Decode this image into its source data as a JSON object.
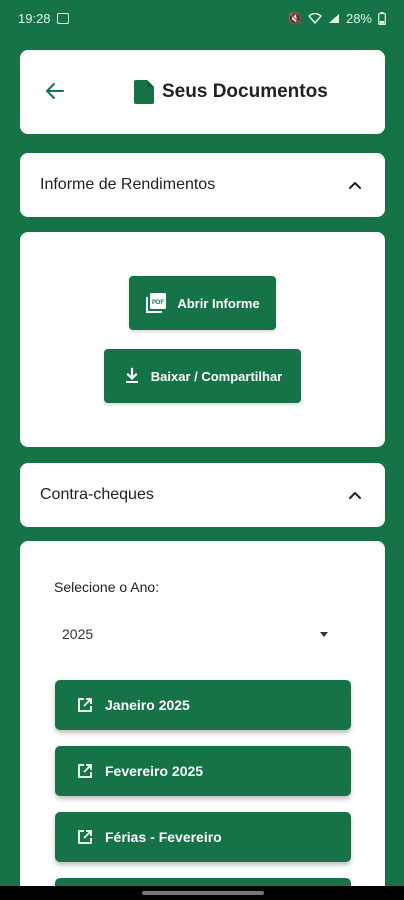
{
  "status_bar": {
    "time": "19:28",
    "battery": "28%"
  },
  "header": {
    "title": "Seus Documentos"
  },
  "informe": {
    "section_title": "Informe de Rendimentos",
    "open_label": "Abrir Informe",
    "download_label": "Baixar / Compartilhar",
    "pdf_icon_text": "PDF"
  },
  "contra": {
    "section_title": "Contra-cheques",
    "select_label": "Selecione o Ano:",
    "selected_year": "2025",
    "items": [
      {
        "label": "Janeiro 2025"
      },
      {
        "label": "Fevereiro 2025"
      },
      {
        "label": "Férias - Fevereiro"
      }
    ]
  },
  "colors": {
    "primary": "#157347",
    "card": "#ffffff"
  },
  "icons": [
    "back-arrow-icon",
    "document-icon",
    "chevron-up-icon",
    "pdf-icon",
    "download-icon",
    "open-external-icon",
    "caret-down-icon"
  ]
}
